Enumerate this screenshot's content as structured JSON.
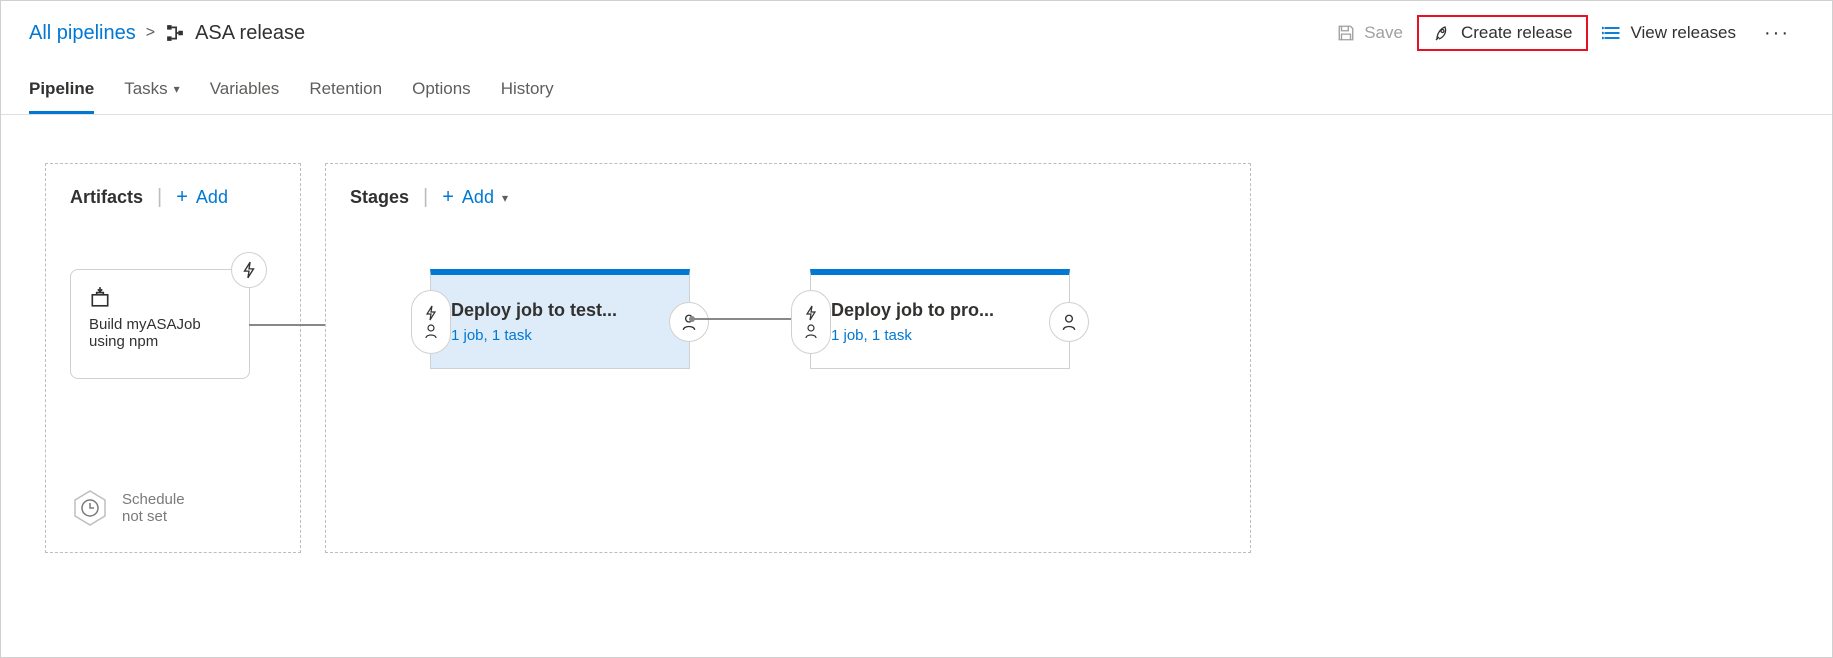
{
  "breadcrumb": {
    "root": "All pipelines",
    "title": "ASA release"
  },
  "toolbar": {
    "save": "Save",
    "create_release": "Create release",
    "view_releases": "View releases"
  },
  "tabs": [
    {
      "label": "Pipeline",
      "active": true
    },
    {
      "label": "Tasks"
    },
    {
      "label": "Variables"
    },
    {
      "label": "Retention"
    },
    {
      "label": "Options"
    },
    {
      "label": "History"
    }
  ],
  "artifacts": {
    "title": "Artifacts",
    "add": "Add",
    "card": {
      "name": "Build myASAJob using npm"
    },
    "schedule": {
      "line1": "Schedule",
      "line2": "not set"
    }
  },
  "stages": {
    "title": "Stages",
    "add": "Add",
    "items": [
      {
        "name": "Deploy job to test...",
        "meta": "1 job, 1 task",
        "selected": true
      },
      {
        "name": "Deploy job to pro...",
        "meta": "1 job, 1 task",
        "selected": false
      }
    ]
  }
}
